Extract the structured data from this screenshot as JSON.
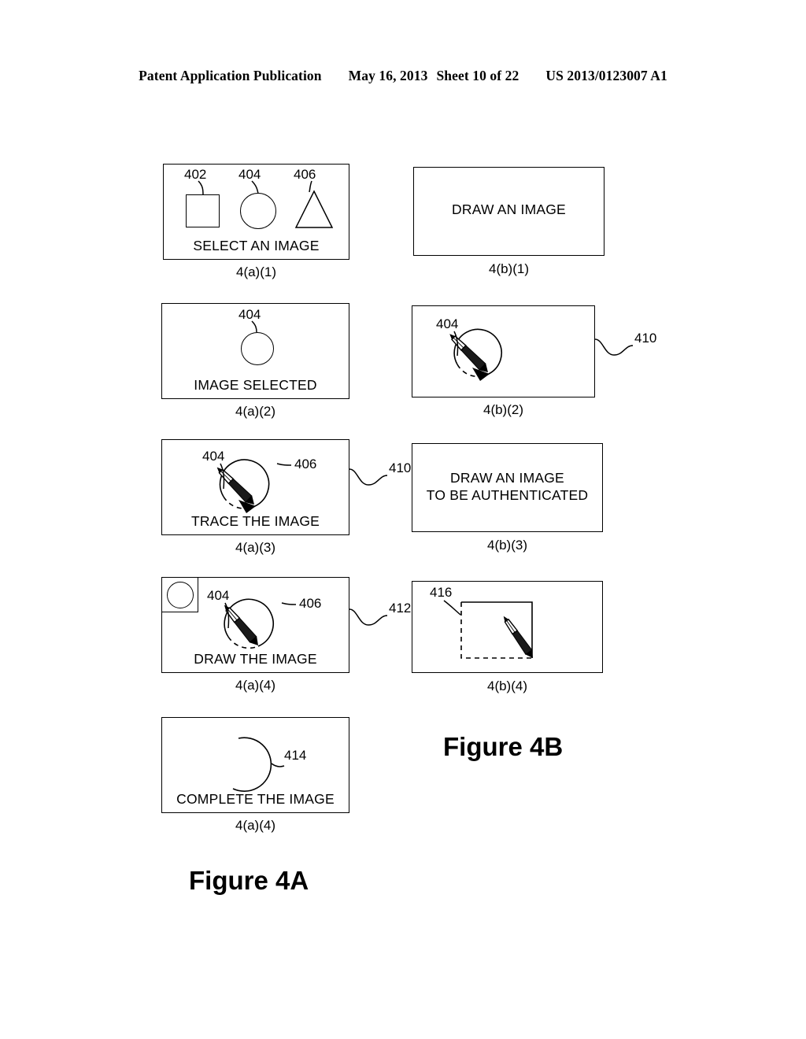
{
  "header": {
    "publication": "Patent Application Publication",
    "date": "May 16, 2013",
    "sheet": "Sheet 10 of 22",
    "patent_number": "US 2013/0123007 A1"
  },
  "figures": {
    "figure_a_title": "Figure 4A",
    "figure_b_title": "Figure 4B"
  },
  "panels": {
    "a1": {
      "caption": "4(a)(1)",
      "prompt": "SELECT AN IMAGE",
      "ref_square": "402",
      "ref_circle": "404",
      "ref_triangle": "406"
    },
    "a2": {
      "caption": "4(a)(2)",
      "prompt": "IMAGE SELECTED",
      "ref_circle": "404"
    },
    "a3": {
      "caption": "4(a)(3)",
      "prompt": "TRACE THE IMAGE",
      "ref_circle": "404",
      "ref_stylus": "406",
      "ref_panel": "410"
    },
    "a4": {
      "caption": "4(a)(4)",
      "prompt": "DRAW THE IMAGE",
      "ref_circle": "404",
      "ref_stylus": "406",
      "ref_panel": "412"
    },
    "a5": {
      "caption": "4(a)(4)",
      "prompt": "COMPLETE THE IMAGE",
      "ref_arc": "414"
    },
    "b1": {
      "caption": "4(b)(1)",
      "prompt": "DRAW AN IMAGE"
    },
    "b2": {
      "caption": "4(b)(2)",
      "ref_circle": "404",
      "ref_panel": "410"
    },
    "b3": {
      "caption": "4(b)(3)",
      "prompt_line1": "DRAW AN IMAGE",
      "prompt_line2": "TO BE AUTHENTICATED"
    },
    "b4": {
      "caption": "4(b)(4)",
      "ref_square": "416"
    }
  },
  "colors": {
    "ink": "#000000",
    "paper": "#ffffff"
  }
}
